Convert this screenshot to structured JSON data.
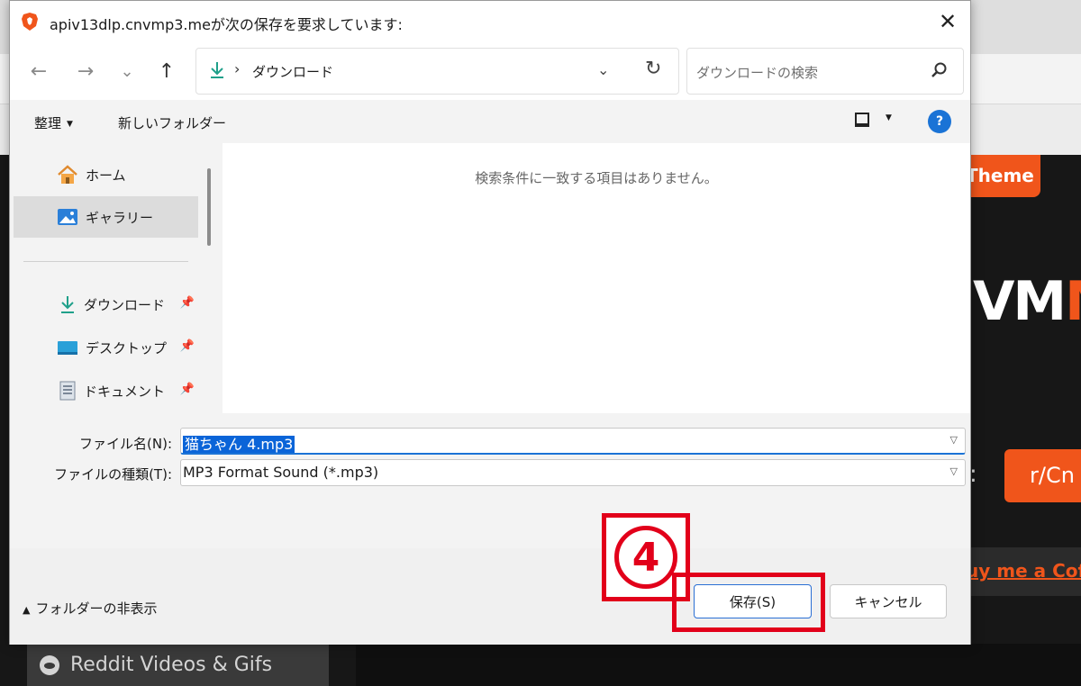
{
  "background": {
    "theme_button": "Theme",
    "logo_white": "VM",
    "logo_orange": "MI",
    "colon": ":",
    "reddit_button": "r/Cn",
    "coffee_link": "uy me a Cof",
    "reddit_menu": "Reddit Videos & Gifs"
  },
  "dialog": {
    "title": "apiv13dlp.cnvmp3.meが次の保存を要求しています:",
    "close_glyph": "✕",
    "nav": {
      "back": "←",
      "forward": "→",
      "recent": "⌄",
      "up": "↑",
      "path_sep": "›",
      "path": "ダウンロード",
      "path_dropdown": "⌄",
      "refresh": "↻"
    },
    "search": {
      "placeholder": "ダウンロードの検索"
    },
    "commands": {
      "organize": "整理",
      "new_folder": "新しいフォルダー",
      "help": "?"
    },
    "sidebar": {
      "items": [
        {
          "label": "ホーム"
        },
        {
          "label": "ギャラリー"
        },
        {
          "label": "ダウンロード"
        },
        {
          "label": "デスクトップ"
        },
        {
          "label": "ドキュメント"
        }
      ]
    },
    "content": {
      "empty_message": "検索条件に一致する項目はありません。"
    },
    "form": {
      "file_name_label": "ファイル名(N):",
      "file_name_value": "猫ちゃん 4.mp3",
      "file_type_label": "ファイルの種類(T):",
      "file_type_value": "MP3 Format Sound (*.mp3)"
    },
    "footer": {
      "hide_folders": "フォルダーの非表示",
      "save": "保存(S)",
      "cancel": "キャンセル"
    }
  },
  "annotation": {
    "step_number": "4",
    "color": "#e2001a"
  },
  "colors": {
    "accent_blue": "#1a73d6",
    "brand_orange": "#f0551b"
  }
}
